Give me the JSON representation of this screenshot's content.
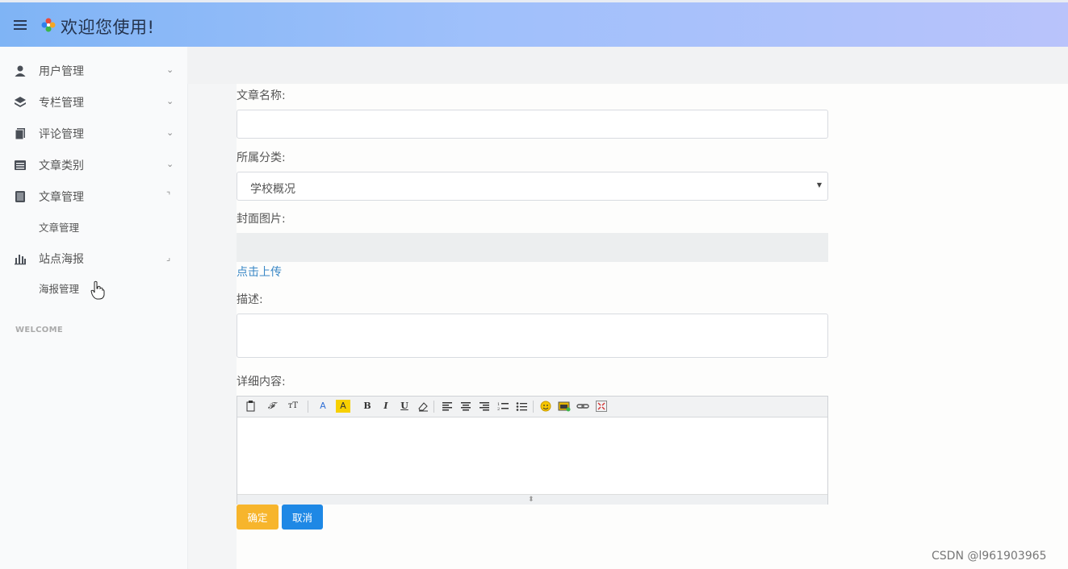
{
  "header": {
    "title": "欢迎您使用!",
    "gradient": [
      "#7fb4f5",
      "#b9c3fb"
    ]
  },
  "sidebar": {
    "items": [
      {
        "label": "用户管理",
        "icon": "user-icon",
        "chevron": "⌄"
      },
      {
        "label": "专栏管理",
        "icon": "layers-icon",
        "chevron": "⌄"
      },
      {
        "label": "评论管理",
        "icon": "document-icon",
        "chevron": "⌄"
      },
      {
        "label": "文章类别",
        "icon": "list-icon",
        "chevron": "⌄"
      },
      {
        "label": "文章管理",
        "icon": "calculator-icon",
        "chevron": "⌝",
        "sub": "文章管理"
      },
      {
        "label": "站点海报",
        "icon": "bar-chart-icon",
        "chevron": "⌟",
        "sub": "海报管理"
      }
    ],
    "welcome": "WELCOME"
  },
  "form": {
    "name_label": "文章名称:",
    "name_value": "",
    "category_label": "所属分类:",
    "category_value": "学校概况",
    "category_arrow": "▼",
    "cover_label": "封面图片:",
    "upload_link": "点击上传",
    "desc_label": "描述:",
    "desc_value": "",
    "detail_label": "详细内容:",
    "toolbar": {
      "font": "𝓕",
      "fontsize": "тT",
      "bold": "B",
      "italic": "I",
      "underline": "U",
      "color_a": "A"
    },
    "ok_label": "确定",
    "cancel_label": "取消"
  },
  "colors": {
    "accent_blue": "#1e88e5",
    "ok_yellow": "#f7b52c",
    "link": "#3a88c6"
  },
  "watermark": "CSDN @l961903965"
}
